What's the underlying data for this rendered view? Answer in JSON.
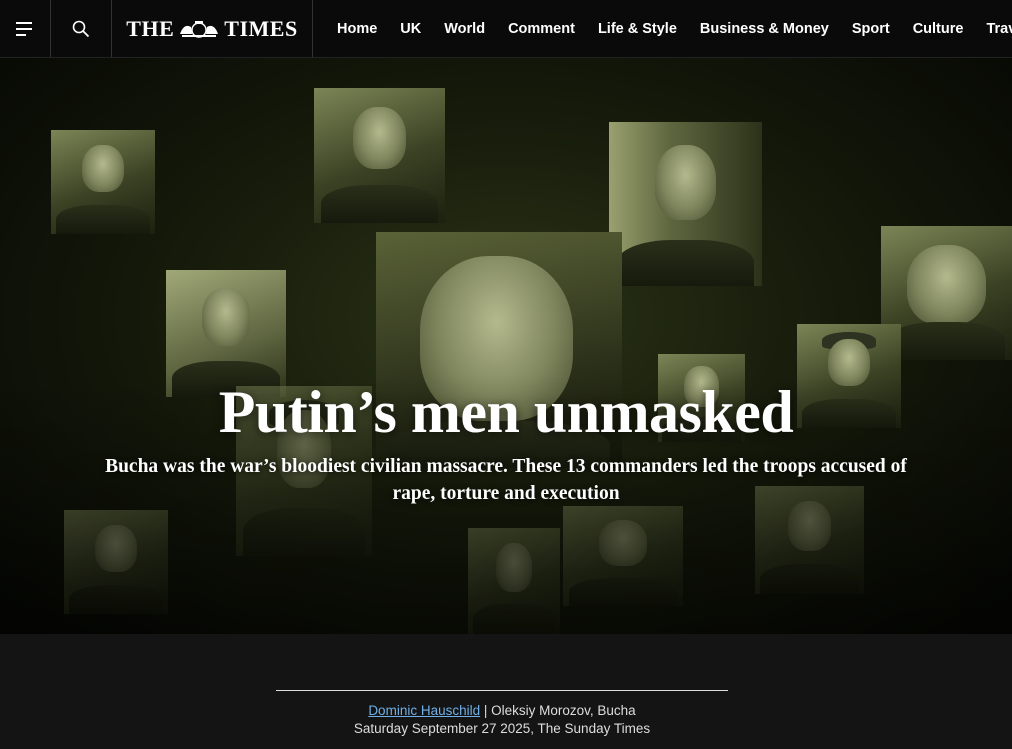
{
  "header": {
    "menu_icon": "hamburger-menu-icon",
    "search_icon": "search-icon",
    "logo_text_left": "THE",
    "logo_text_right": "TIMES",
    "nav": [
      "Home",
      "UK",
      "World",
      "Comment",
      "Life & Style",
      "Business & Money",
      "Sport",
      "Culture",
      "Travel"
    ]
  },
  "hero": {
    "headline": "Putin’s men unmasked",
    "standfirst": "Bucha was the war’s bloodiest civilian massacre. These 13 commanders led the troops accused of rape, torture and execution"
  },
  "byline": {
    "author": "Dominic Hauschild",
    "separator": " | ",
    "contributor": "Oleksiy Morozov, Bucha",
    "date": "Saturday September 27 2025, The Sunday Times"
  },
  "colors": {
    "link": "#6fb0e8",
    "background": "#141414",
    "nav_background": "#0a0a0a"
  }
}
